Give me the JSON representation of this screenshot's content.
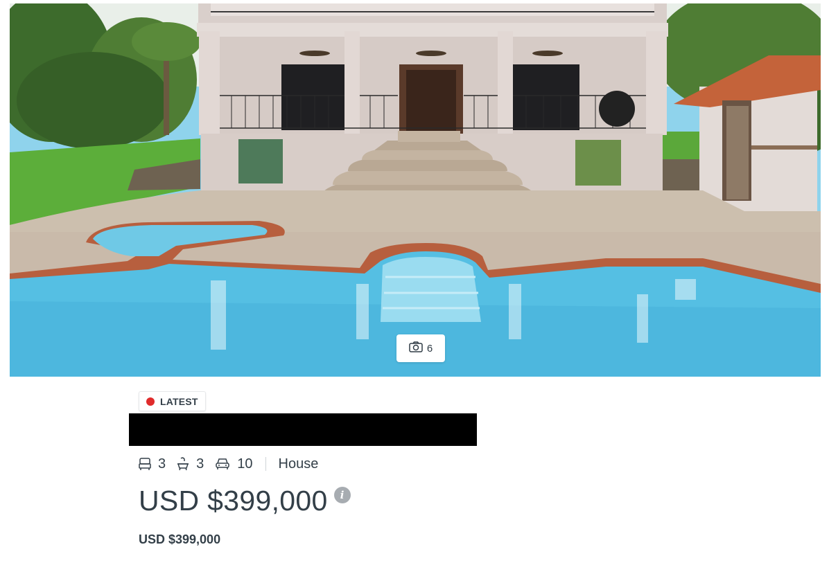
{
  "listing": {
    "badge_label": "LATEST",
    "bedrooms": "3",
    "bathrooms": "3",
    "parking": "10",
    "property_type": "House",
    "price": "USD $399,000",
    "price_secondary": "USD $399,000",
    "photo_count": "6"
  },
  "icons": {
    "bed": "bed-icon",
    "bath": "bath-icon",
    "car": "car-icon",
    "camera": "camera-icon",
    "info": "info-icon",
    "badge_dot": "red-dot"
  },
  "colors": {
    "text": "#333f48",
    "badge_dot": "#e02b2b",
    "info_icon": "#a7acb1"
  }
}
